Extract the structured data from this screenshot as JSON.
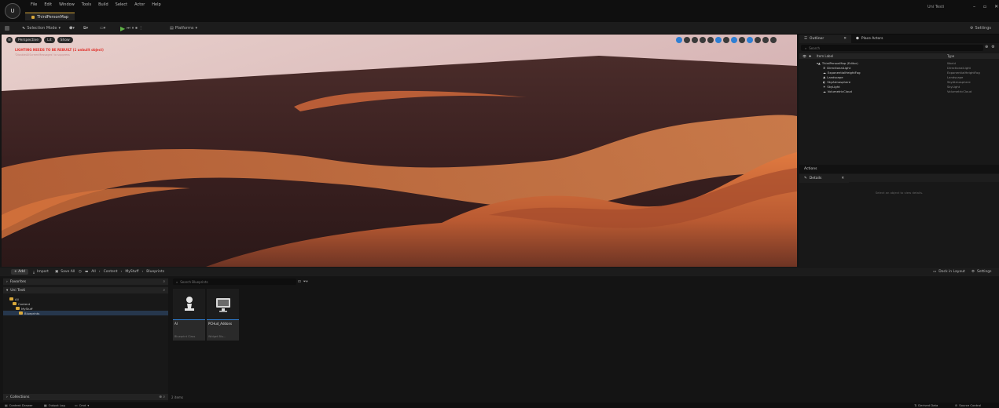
{
  "app": {
    "logo_text": "U",
    "menu": [
      "File",
      "Edit",
      "Window",
      "Tools",
      "Build",
      "Select",
      "Actor",
      "Help"
    ],
    "map_tab": "ThirdPersonMap",
    "project_name": "Uni Testi",
    "window_controls": [
      "–",
      "▫",
      "✕"
    ]
  },
  "toolbar": {
    "save": "💾",
    "mode": "Selection Mode",
    "platforms": "Platforms",
    "settings": "Settings"
  },
  "viewport": {
    "perspective": "Perspective",
    "lit": "Lit",
    "show": "Show",
    "warning_title": "LIGHTING NEEDS TO BE REBUILT (1 unbuilt object)",
    "warning_sub": "'DisableAllScreenMessages' to suppress"
  },
  "outliner": {
    "tab_label": "Outliner",
    "tab2_label": "Place Actors",
    "search_placeholder": "Search",
    "col_label": "Item Label",
    "col_type": "Type",
    "rows": [
      {
        "label": "ThirdPersonMap (Editor)",
        "type": "World",
        "icon": "map-icon",
        "depth": 0
      },
      {
        "label": "DirectionalLight",
        "type": "DirectionalLight",
        "icon": "sun-icon",
        "depth": 1
      },
      {
        "label": "ExponentialHeightFog",
        "type": "ExponentialHeightFog",
        "icon": "fog-icon",
        "depth": 1
      },
      {
        "label": "Landscape",
        "type": "Landscape",
        "icon": "landscape-icon",
        "depth": 1
      },
      {
        "label": "SkyAtmosphere",
        "type": "SkyAtmosphere",
        "icon": "sky-icon",
        "depth": 1
      },
      {
        "label": "SkyLight",
        "type": "SkyLight",
        "icon": "skylight-icon",
        "depth": 1
      },
      {
        "label": "VolumetricCloud",
        "type": "VolumetricCloud",
        "icon": "cloud-icon",
        "depth": 1
      }
    ]
  },
  "details": {
    "panel_label": "Actions",
    "tab_label": "Details",
    "empty_text": "Select an object to view details."
  },
  "content_browser": {
    "add_label": "+ Add",
    "import_label": "Import",
    "save_all_label": "Save All",
    "breadcrumb": [
      "All",
      "Content",
      "MyStuff",
      "Blueprints"
    ],
    "dock_label": "Dock in Layout",
    "settings_label": "Settings",
    "favorites_label": "Favorites",
    "project_label": "Uni Testi",
    "tree": [
      {
        "label": "All",
        "depth": 0
      },
      {
        "label": "Content",
        "depth": 1
      },
      {
        "label": "MyStuff",
        "depth": 2
      },
      {
        "label": "Blueprints",
        "depth": 3
      }
    ],
    "search_placeholder": "Search Blueprints",
    "assets": [
      {
        "name": "AI",
        "kind": "Blueprint Class",
        "icon": "pawn-icon"
      },
      {
        "name": "PCHud_Addons",
        "kind": "Widget Blu...",
        "icon": "monitor-icon"
      }
    ],
    "count_label": "2 items",
    "collections_label": "Collections"
  },
  "status": {
    "content_drawer": "Content Drawer",
    "output_log": "Output Log",
    "cmd": "Cmd",
    "source_control": "Source Control",
    "derived_data": "Derived Data"
  }
}
